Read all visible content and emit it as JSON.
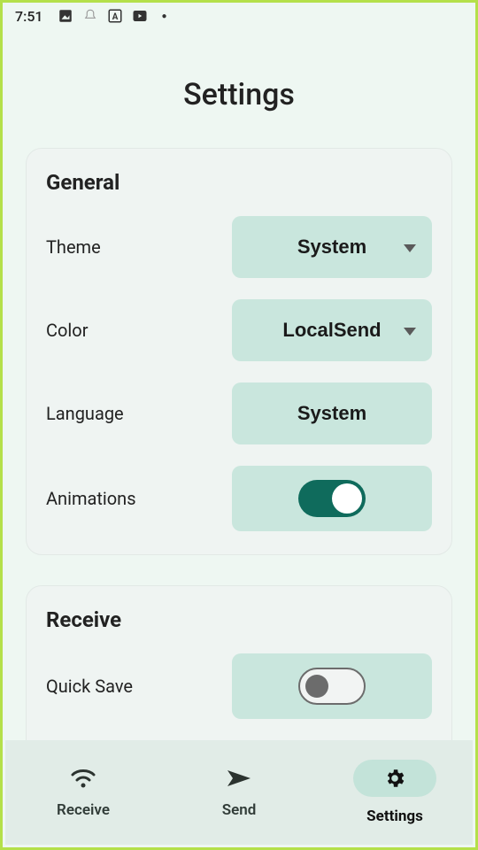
{
  "status": {
    "time": "7:51"
  },
  "title": "Settings",
  "general": {
    "heading": "General",
    "theme_label": "Theme",
    "theme_value": "System",
    "color_label": "Color",
    "color_value": "LocalSend",
    "language_label": "Language",
    "language_value": "System",
    "animations_label": "Animations",
    "animations_on": true
  },
  "receive": {
    "heading": "Receive",
    "quicksave_label": "Quick Save",
    "quicksave_on": false
  },
  "nav": {
    "receive": "Receive",
    "send": "Send",
    "settings": "Settings"
  }
}
